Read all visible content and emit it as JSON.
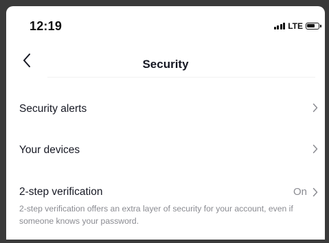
{
  "status_bar": {
    "time": "12:19",
    "network": "LTE",
    "signal_bars": 4,
    "battery_level": 0.75
  },
  "header": {
    "back_icon": "chevron-left-icon",
    "title": "Security"
  },
  "settings": {
    "items": [
      {
        "label": "Security alerts",
        "value": ""
      },
      {
        "label": "Your devices",
        "value": ""
      },
      {
        "label": "2-step verification",
        "value": "On"
      }
    ],
    "two_step_description": "2-step verification offers an extra layer of security for your account, even if someone knows your password."
  },
  "colors": {
    "text_primary": "#161823",
    "text_secondary": "#8a8b91",
    "divider": "#f1f1f2",
    "background": "#ffffff"
  }
}
